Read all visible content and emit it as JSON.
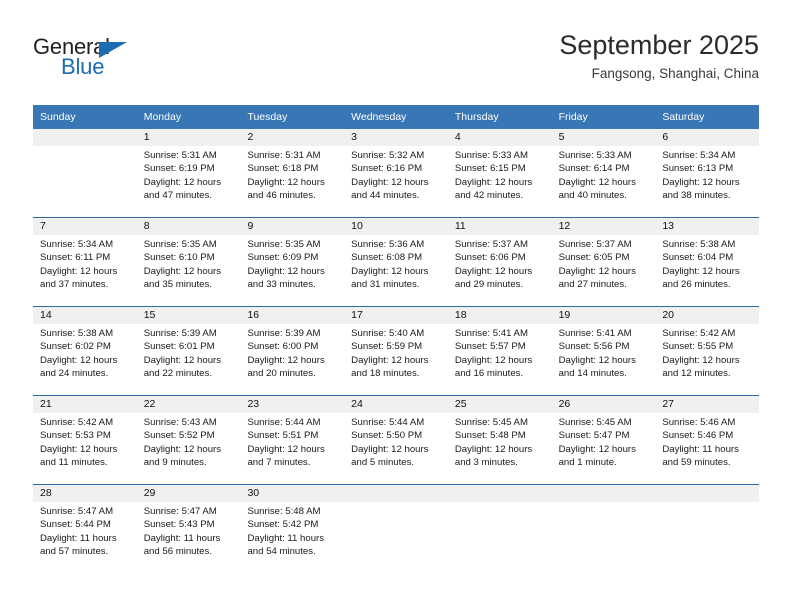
{
  "brand": {
    "name_part1": "General",
    "name_part2": "Blue",
    "accent_color": "#1c6cb5"
  },
  "header": {
    "title": "September 2025",
    "subtitle": "Fangsong, Shanghai, China"
  },
  "theme": {
    "header_row_bg": "#3876b5",
    "week_border": "#2e6da4",
    "day_band_bg": "#f0f0f0"
  },
  "weekdays": [
    "Sunday",
    "Monday",
    "Tuesday",
    "Wednesday",
    "Thursday",
    "Friday",
    "Saturday"
  ],
  "weeks": [
    [
      {
        "day": "",
        "empty": true,
        "l1": "",
        "l2": "",
        "l3": "",
        "l4": ""
      },
      {
        "day": "1",
        "l1": "Sunrise: 5:31 AM",
        "l2": "Sunset: 6:19 PM",
        "l3": "Daylight: 12 hours",
        "l4": "and 47 minutes."
      },
      {
        "day": "2",
        "l1": "Sunrise: 5:31 AM",
        "l2": "Sunset: 6:18 PM",
        "l3": "Daylight: 12 hours",
        "l4": "and 46 minutes."
      },
      {
        "day": "3",
        "l1": "Sunrise: 5:32 AM",
        "l2": "Sunset: 6:16 PM",
        "l3": "Daylight: 12 hours",
        "l4": "and 44 minutes."
      },
      {
        "day": "4",
        "l1": "Sunrise: 5:33 AM",
        "l2": "Sunset: 6:15 PM",
        "l3": "Daylight: 12 hours",
        "l4": "and 42 minutes."
      },
      {
        "day": "5",
        "l1": "Sunrise: 5:33 AM",
        "l2": "Sunset: 6:14 PM",
        "l3": "Daylight: 12 hours",
        "l4": "and 40 minutes."
      },
      {
        "day": "6",
        "l1": "Sunrise: 5:34 AM",
        "l2": "Sunset: 6:13 PM",
        "l3": "Daylight: 12 hours",
        "l4": "and 38 minutes."
      }
    ],
    [
      {
        "day": "7",
        "l1": "Sunrise: 5:34 AM",
        "l2": "Sunset: 6:11 PM",
        "l3": "Daylight: 12 hours",
        "l4": "and 37 minutes."
      },
      {
        "day": "8",
        "l1": "Sunrise: 5:35 AM",
        "l2": "Sunset: 6:10 PM",
        "l3": "Daylight: 12 hours",
        "l4": "and 35 minutes."
      },
      {
        "day": "9",
        "l1": "Sunrise: 5:35 AM",
        "l2": "Sunset: 6:09 PM",
        "l3": "Daylight: 12 hours",
        "l4": "and 33 minutes."
      },
      {
        "day": "10",
        "l1": "Sunrise: 5:36 AM",
        "l2": "Sunset: 6:08 PM",
        "l3": "Daylight: 12 hours",
        "l4": "and 31 minutes."
      },
      {
        "day": "11",
        "l1": "Sunrise: 5:37 AM",
        "l2": "Sunset: 6:06 PM",
        "l3": "Daylight: 12 hours",
        "l4": "and 29 minutes."
      },
      {
        "day": "12",
        "l1": "Sunrise: 5:37 AM",
        "l2": "Sunset: 6:05 PM",
        "l3": "Daylight: 12 hours",
        "l4": "and 27 minutes."
      },
      {
        "day": "13",
        "l1": "Sunrise: 5:38 AM",
        "l2": "Sunset: 6:04 PM",
        "l3": "Daylight: 12 hours",
        "l4": "and 26 minutes."
      }
    ],
    [
      {
        "day": "14",
        "l1": "Sunrise: 5:38 AM",
        "l2": "Sunset: 6:02 PM",
        "l3": "Daylight: 12 hours",
        "l4": "and 24 minutes."
      },
      {
        "day": "15",
        "l1": "Sunrise: 5:39 AM",
        "l2": "Sunset: 6:01 PM",
        "l3": "Daylight: 12 hours",
        "l4": "and 22 minutes."
      },
      {
        "day": "16",
        "l1": "Sunrise: 5:39 AM",
        "l2": "Sunset: 6:00 PM",
        "l3": "Daylight: 12 hours",
        "l4": "and 20 minutes."
      },
      {
        "day": "17",
        "l1": "Sunrise: 5:40 AM",
        "l2": "Sunset: 5:59 PM",
        "l3": "Daylight: 12 hours",
        "l4": "and 18 minutes."
      },
      {
        "day": "18",
        "l1": "Sunrise: 5:41 AM",
        "l2": "Sunset: 5:57 PM",
        "l3": "Daylight: 12 hours",
        "l4": "and 16 minutes."
      },
      {
        "day": "19",
        "l1": "Sunrise: 5:41 AM",
        "l2": "Sunset: 5:56 PM",
        "l3": "Daylight: 12 hours",
        "l4": "and 14 minutes."
      },
      {
        "day": "20",
        "l1": "Sunrise: 5:42 AM",
        "l2": "Sunset: 5:55 PM",
        "l3": "Daylight: 12 hours",
        "l4": "and 12 minutes."
      }
    ],
    [
      {
        "day": "21",
        "l1": "Sunrise: 5:42 AM",
        "l2": "Sunset: 5:53 PM",
        "l3": "Daylight: 12 hours",
        "l4": "and 11 minutes."
      },
      {
        "day": "22",
        "l1": "Sunrise: 5:43 AM",
        "l2": "Sunset: 5:52 PM",
        "l3": "Daylight: 12 hours",
        "l4": "and 9 minutes."
      },
      {
        "day": "23",
        "l1": "Sunrise: 5:44 AM",
        "l2": "Sunset: 5:51 PM",
        "l3": "Daylight: 12 hours",
        "l4": "and 7 minutes."
      },
      {
        "day": "24",
        "l1": "Sunrise: 5:44 AM",
        "l2": "Sunset: 5:50 PM",
        "l3": "Daylight: 12 hours",
        "l4": "and 5 minutes."
      },
      {
        "day": "25",
        "l1": "Sunrise: 5:45 AM",
        "l2": "Sunset: 5:48 PM",
        "l3": "Daylight: 12 hours",
        "l4": "and 3 minutes."
      },
      {
        "day": "26",
        "l1": "Sunrise: 5:45 AM",
        "l2": "Sunset: 5:47 PM",
        "l3": "Daylight: 12 hours",
        "l4": "and 1 minute."
      },
      {
        "day": "27",
        "l1": "Sunrise: 5:46 AM",
        "l2": "Sunset: 5:46 PM",
        "l3": "Daylight: 11 hours",
        "l4": "and 59 minutes."
      }
    ],
    [
      {
        "day": "28",
        "l1": "Sunrise: 5:47 AM",
        "l2": "Sunset: 5:44 PM",
        "l3": "Daylight: 11 hours",
        "l4": "and 57 minutes."
      },
      {
        "day": "29",
        "l1": "Sunrise: 5:47 AM",
        "l2": "Sunset: 5:43 PM",
        "l3": "Daylight: 11 hours",
        "l4": "and 56 minutes."
      },
      {
        "day": "30",
        "l1": "Sunrise: 5:48 AM",
        "l2": "Sunset: 5:42 PM",
        "l3": "Daylight: 11 hours",
        "l4": "and 54 minutes."
      },
      {
        "day": "",
        "empty": true,
        "l1": "",
        "l2": "",
        "l3": "",
        "l4": ""
      },
      {
        "day": "",
        "empty": true,
        "l1": "",
        "l2": "",
        "l3": "",
        "l4": ""
      },
      {
        "day": "",
        "empty": true,
        "l1": "",
        "l2": "",
        "l3": "",
        "l4": ""
      },
      {
        "day": "",
        "empty": true,
        "l1": "",
        "l2": "",
        "l3": "",
        "l4": ""
      }
    ]
  ]
}
